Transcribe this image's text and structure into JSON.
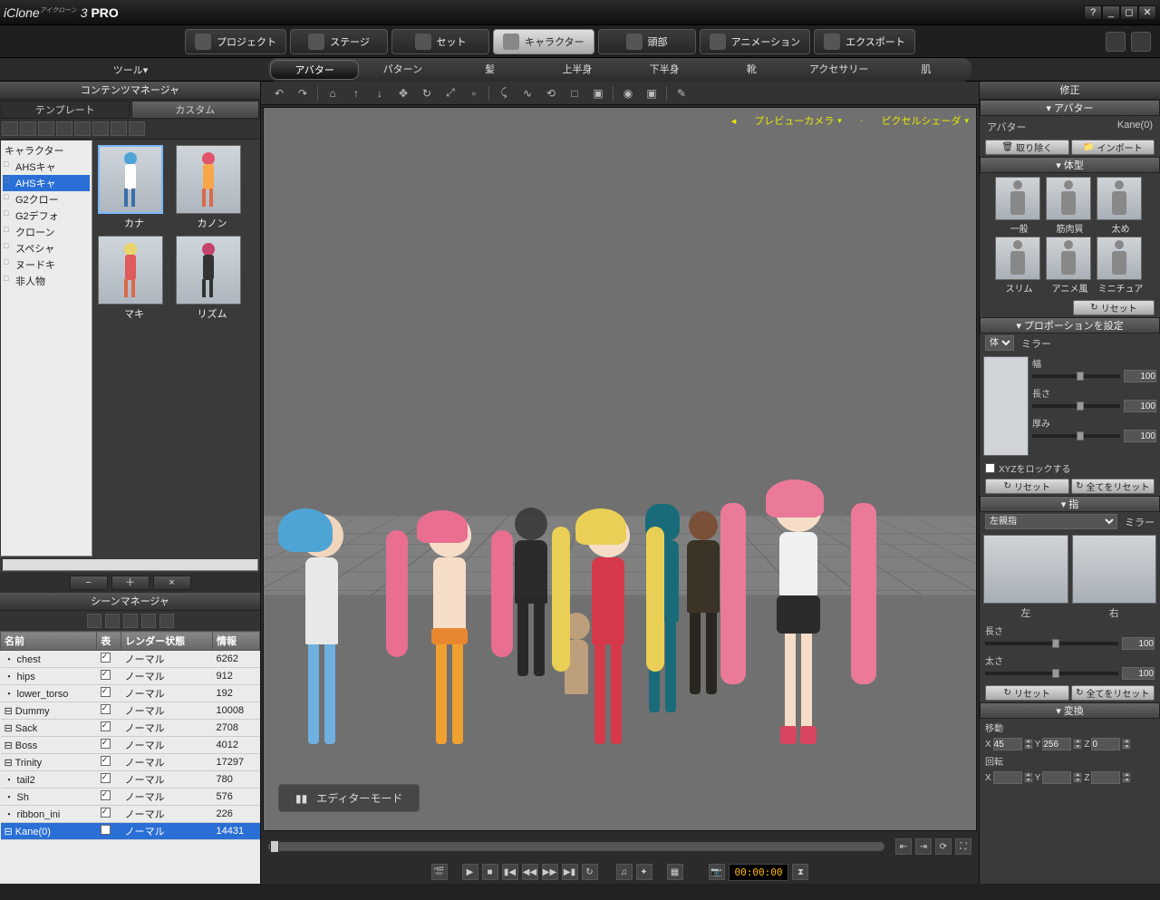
{
  "app": {
    "title_prefix": "iClone",
    "title_suffix": "3",
    "title_edition": "PRO",
    "title_sup": "アイクローン"
  },
  "mainTabs": [
    {
      "label": "プロジェクト"
    },
    {
      "label": "ステージ"
    },
    {
      "label": "セット"
    },
    {
      "label": "キャラクター",
      "active": true
    },
    {
      "label": "頭部"
    },
    {
      "label": "アニメーション"
    },
    {
      "label": "エクスポート"
    }
  ],
  "toolMenu": "ツール▾",
  "subTabs": [
    {
      "label": "アバター",
      "active": true
    },
    {
      "label": "パターン"
    },
    {
      "label": "髪"
    },
    {
      "label": "上半身"
    },
    {
      "label": "下半身"
    },
    {
      "label": "靴"
    },
    {
      "label": "アクセサリー"
    },
    {
      "label": "肌"
    }
  ],
  "contentMgr": {
    "title": "コンテンツマネージャ",
    "tabs": [
      {
        "label": "テンプレート"
      },
      {
        "label": "カスタム",
        "active": true
      }
    ],
    "tree": [
      {
        "label": "キャラクター",
        "root": true
      },
      {
        "label": "AHSキャ"
      },
      {
        "label": "AHSキャ",
        "sel": true
      },
      {
        "label": "G2クロー"
      },
      {
        "label": "G2デフォ"
      },
      {
        "label": "クローン"
      },
      {
        "label": "スペシャ"
      },
      {
        "label": "ヌードキ"
      },
      {
        "label": "非人物"
      }
    ],
    "thumbs": [
      {
        "label": "カナ",
        "sel": true,
        "hair": "#4fa4d6",
        "top": "#fff",
        "bottom": "#3a6fa8"
      },
      {
        "label": "カノン",
        "hair": "#e0556b",
        "top": "#f7a74a",
        "bottom": "#d96a4a"
      },
      {
        "label": "マキ",
        "hair": "#e9d66b",
        "top": "#e05b5b",
        "bottom": "#d96a4a"
      },
      {
        "label": "リズム",
        "hair": "#c7426a",
        "top": "#333",
        "bottom": "#333"
      }
    ],
    "bottomBtns": [
      "−",
      "＋",
      "×"
    ]
  },
  "sceneMgr": {
    "title": "シーンマネージャ",
    "headers": {
      "name": "名前",
      "display": "表",
      "render": "レンダー状態",
      "info": "情報"
    },
    "rows": [
      {
        "name": "  ・ chest",
        "render": "ノーマル",
        "info": "6262"
      },
      {
        "name": "  ・ hips",
        "render": "ノーマル",
        "info": "912"
      },
      {
        "name": "  ・ lower_torso",
        "render": "ノーマル",
        "info": "192"
      },
      {
        "name": "⊟ Dummy",
        "render": "ノーマル",
        "info": "10008"
      },
      {
        "name": "⊟ Sack",
        "render": "ノーマル",
        "info": "2708"
      },
      {
        "name": "⊟ Boss",
        "render": "ノーマル",
        "info": "4012"
      },
      {
        "name": "⊟ Trinity",
        "render": "ノーマル",
        "info": "17297"
      },
      {
        "name": "  ・ tail2",
        "render": "ノーマル",
        "info": "780"
      },
      {
        "name": "  ・ Sh",
        "render": "ノーマル",
        "info": "576"
      },
      {
        "name": "  ・ ribbon_ini",
        "render": "ノーマル",
        "info": "226"
      },
      {
        "name": "⊟ Kane(0)",
        "render": "ノーマル",
        "info": "14431",
        "sel": true
      }
    ]
  },
  "viewport": {
    "camera": "プレビューカメラ",
    "shader": "ピクセルシェーダ",
    "editorMode": "エディターモード",
    "time": "00:00:00"
  },
  "right": {
    "title": "修正",
    "avatar": {
      "section": "アバター",
      "label": "アバター",
      "value": "Kane(0)",
      "remove": "取り除く",
      "import": "インポート"
    },
    "bodyType": {
      "section": "体型",
      "types": [
        {
          "label": "一般"
        },
        {
          "label": "筋肉質"
        },
        {
          "label": "太め"
        },
        {
          "label": "スリム"
        },
        {
          "label": "アニメ風"
        },
        {
          "label": "ミニチュア"
        }
      ],
      "reset": "リセット"
    },
    "proportion": {
      "section": "プロポーションを設定",
      "dropdown": "体",
      "mirror": "ミラー",
      "sliders": [
        {
          "label": "幅",
          "val": "100"
        },
        {
          "label": "長さ",
          "val": "100"
        },
        {
          "label": "厚み",
          "val": "100"
        }
      ],
      "lock": "XYZをロックする",
      "reset": "リセット",
      "resetAll": "全てをリセット"
    },
    "finger": {
      "section": "指",
      "dropdown": "左親指",
      "mirror": "ミラー",
      "left": "左",
      "right": "右",
      "sliders": [
        {
          "label": "長さ",
          "val": "100"
        },
        {
          "label": "太さ",
          "val": "100"
        }
      ],
      "reset": "リセット",
      "resetAll": "全てをリセット"
    },
    "transform": {
      "section": "変換",
      "move": "移動",
      "rotate": "回転",
      "mx": "45",
      "my": "256",
      "mz": "0",
      "rx": "",
      "ry": "",
      "rz": ""
    }
  }
}
